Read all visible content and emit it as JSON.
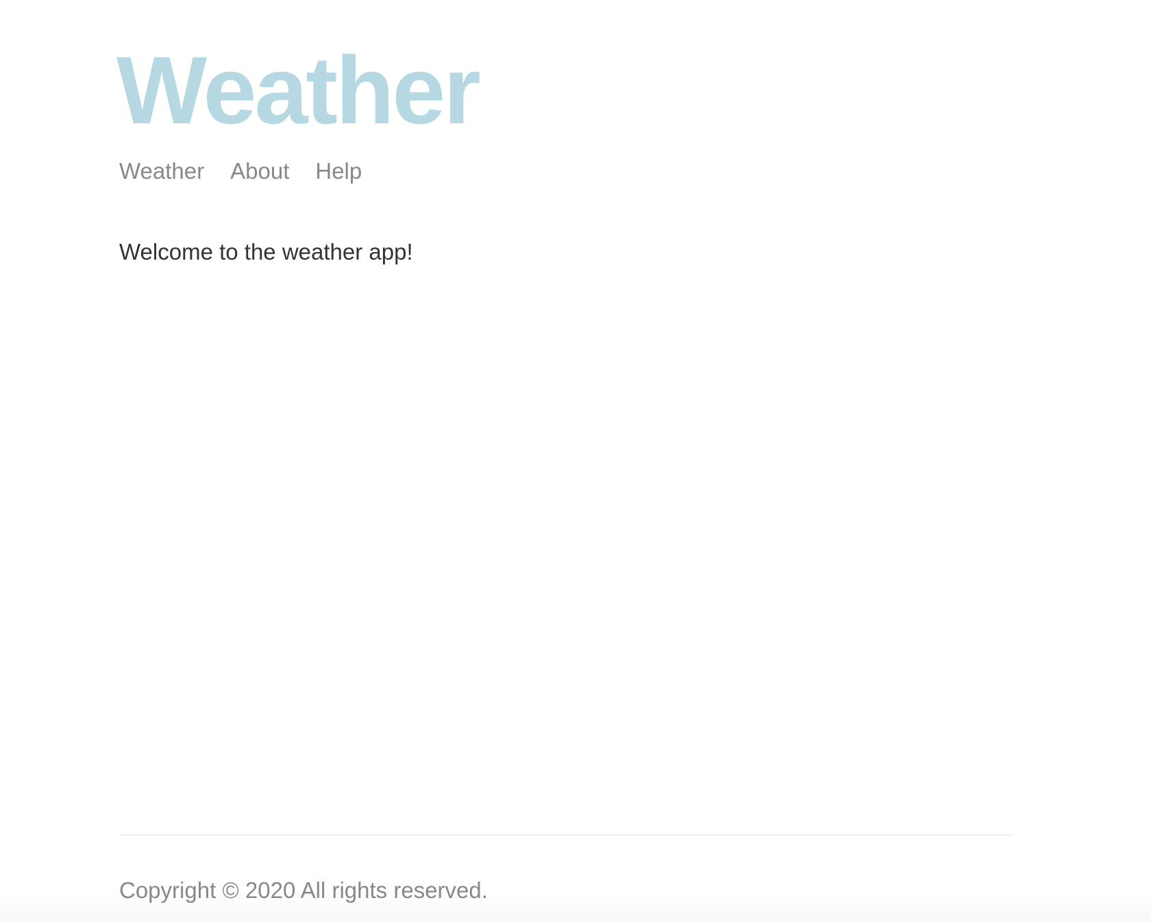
{
  "header": {
    "title": "Weather"
  },
  "nav": {
    "items": [
      {
        "label": "Weather"
      },
      {
        "label": "About"
      },
      {
        "label": "Help"
      }
    ]
  },
  "main": {
    "welcome": "Welcome to the weather app!"
  },
  "footer": {
    "copyright": "Copyright © 2020 All rights reserved."
  },
  "colors": {
    "title": "#b6d8e3",
    "nav_link": "#888888",
    "body_text": "#333333",
    "footer_text": "#888888",
    "divider": "#eeeeee"
  }
}
